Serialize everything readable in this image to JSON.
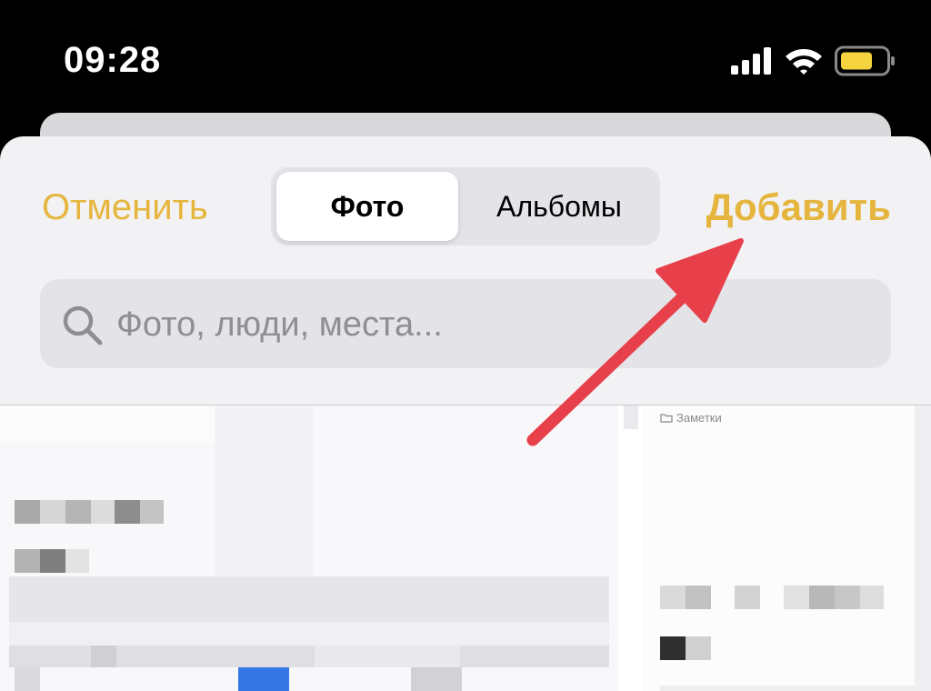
{
  "status_bar": {
    "time": "09:28",
    "icons": [
      "signal-icon",
      "wifi-icon",
      "battery-icon"
    ],
    "battery_color": "#f4d33e"
  },
  "sheet": {
    "cancel_label": "Отменить",
    "add_label": "Добавить",
    "tabs": [
      {
        "label": "Фото",
        "selected": true
      },
      {
        "label": "Альбомы",
        "selected": false
      }
    ],
    "search": {
      "placeholder": "Фото, люди, места..."
    }
  },
  "preview": {
    "notes_label": "Заметки"
  },
  "colors": {
    "accent": "#e5b53e",
    "annotation_arrow": "#e8404a"
  }
}
